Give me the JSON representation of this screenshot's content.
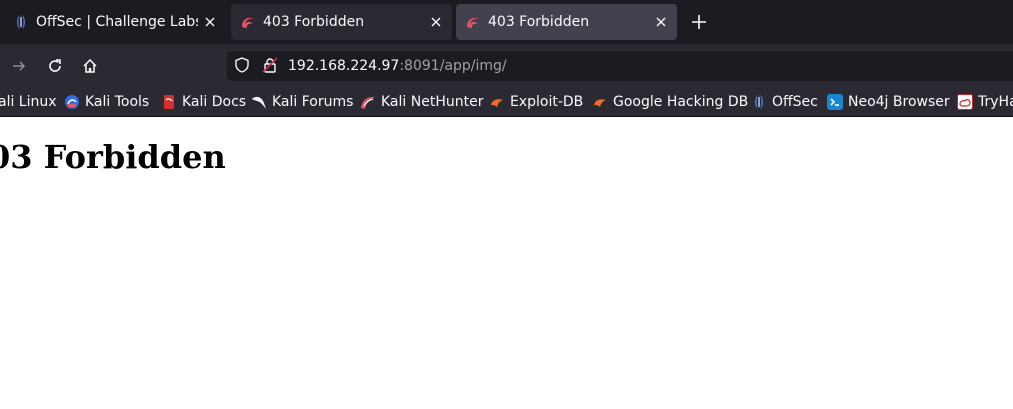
{
  "tabs": [
    {
      "title": "OffSec | Challenge Labs",
      "active": false
    },
    {
      "title": "403 Forbidden",
      "active": false
    },
    {
      "title": "403 Forbidden",
      "active": true
    }
  ],
  "url": {
    "host": "192.168.224.97",
    "rest": ":8091/app/img/"
  },
  "bookmarks": [
    {
      "label": "ali Linux",
      "icon": "kali-icon"
    },
    {
      "label": "Kali Tools",
      "icon": "kali-tools-icon"
    },
    {
      "label": "Kali Docs",
      "icon": "kali-docs-icon"
    },
    {
      "label": "Kali Forums",
      "icon": "kali-forums-icon"
    },
    {
      "label": "Kali NetHunter",
      "icon": "nethunter-icon"
    },
    {
      "label": "Exploit-DB",
      "icon": "exploit-db-icon"
    },
    {
      "label": "Google Hacking DB",
      "icon": "ghdb-icon"
    },
    {
      "label": "OffSec",
      "icon": "offsec-icon"
    },
    {
      "label": "Neo4j Browser",
      "icon": "neo4j-icon"
    },
    {
      "label": "TryHa",
      "icon": "tryhackme-icon"
    }
  ],
  "page": {
    "heading": "03 Forbidden"
  },
  "colors": {
    "chrome_dark": "#1c1b22",
    "chrome": "#2b2a33",
    "active_tab": "#42414d",
    "text": "#fbfbfe"
  }
}
